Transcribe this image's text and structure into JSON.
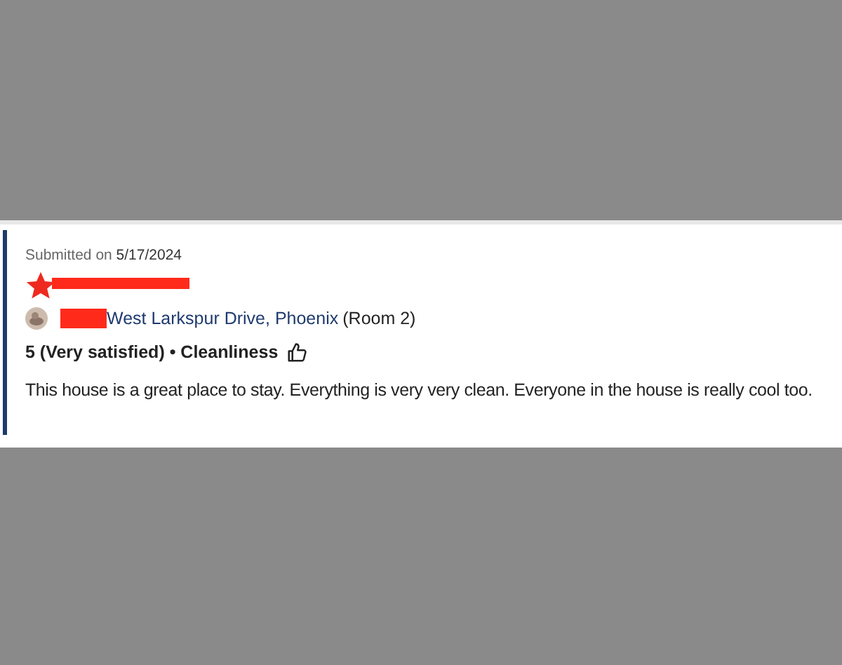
{
  "review": {
    "submitted_label": "Submitted on ",
    "submitted_date": "5/17/2024",
    "property_link": "West Larkspur Drive, Phoenix",
    "room": "(Room 2)",
    "rating": "5 (Very satisfied) • Cleanliness",
    "comment": "This house is a great place to stay. Everything is very very clean. Everyone in the house is really cool too."
  }
}
